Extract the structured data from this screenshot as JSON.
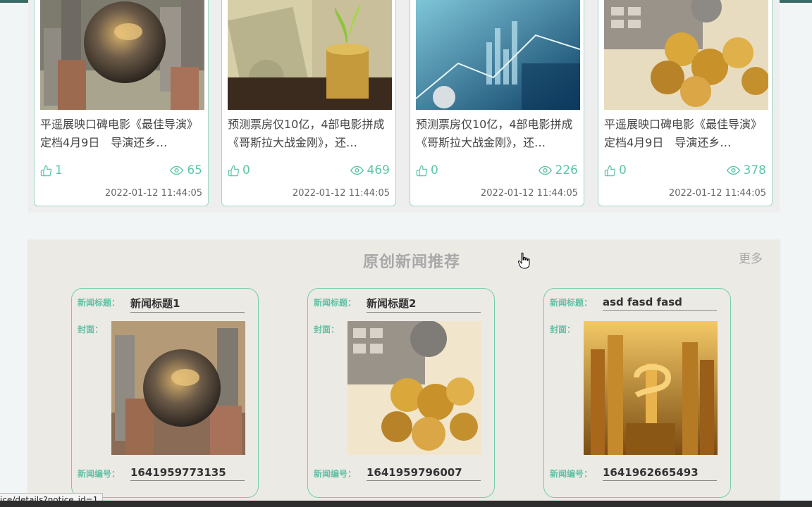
{
  "upper_cards": [
    {
      "title": "平遥展映口碑电影《最佳导演》定档4月9日　导演还乡…",
      "likes": "1",
      "views": "65",
      "date": "2022-01-12 11:44:05",
      "image": "coins-globe"
    },
    {
      "title": "预测票房仅10亿，4部电影拼成《哥斯拉大战金刚》，还…",
      "likes": "0",
      "views": "469",
      "date": "2022-01-12 11:44:05",
      "image": "money-plant"
    },
    {
      "title": "预测票房仅10亿，4部电影拼成《哥斯拉大战金刚》，还…",
      "likes": "0",
      "views": "226",
      "date": "2022-01-12 11:44:05",
      "image": "finance-chart"
    },
    {
      "title": "平遥展映口碑电影《最佳导演》定档4月9日　导演还乡…",
      "likes": "0",
      "views": "378",
      "date": "2022-01-12 11:44:05",
      "image": "gold-coins"
    }
  ],
  "recommend": {
    "title": "原创新闻推荐",
    "more": "更多",
    "labels": {
      "news_title": "新闻标题：",
      "cover": "封面：",
      "news_no": "新闻编号："
    },
    "items": [
      {
        "news_title": "新闻标题1",
        "news_no": "1641959773135",
        "image": "coins-globe"
      },
      {
        "news_title": "新闻标题2",
        "news_no": "1641959796007",
        "image": "gold-coins"
      },
      {
        "news_title": "asd fasd fasd",
        "news_no": "1641962665493",
        "image": "golden-city"
      }
    ]
  },
  "status_url": "ice/details?notice_id=1",
  "colors": {
    "accent": "#5fc4a8",
    "card_border": "#9fd8c8",
    "section_bg": "#eceae5"
  },
  "icons": {
    "likes": "thumbs-up-icon",
    "views": "eye-icon",
    "cursor": "hand-pointer-icon"
  }
}
